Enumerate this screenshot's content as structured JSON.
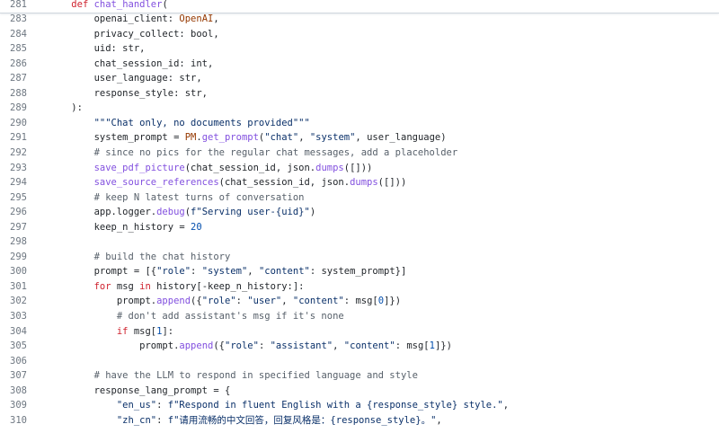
{
  "code_view": {
    "sticky_header": {
      "line_no": "281",
      "tokens": [
        {
          "t": "    "
        },
        {
          "t": "def",
          "c": "kw"
        },
        {
          "t": " "
        },
        {
          "t": "chat_handler",
          "c": "fn"
        },
        {
          "t": "("
        }
      ]
    },
    "lines": [
      {
        "no": "283",
        "tokens": [
          {
            "t": "        openai_client: "
          },
          {
            "t": "OpenAI",
            "c": "cls"
          },
          {
            "t": ","
          }
        ]
      },
      {
        "no": "284",
        "tokens": [
          {
            "t": "        privacy_collect: bool,"
          }
        ]
      },
      {
        "no": "285",
        "tokens": [
          {
            "t": "        uid: str,"
          }
        ]
      },
      {
        "no": "286",
        "tokens": [
          {
            "t": "        chat_session_id: int,"
          }
        ]
      },
      {
        "no": "287",
        "tokens": [
          {
            "t": "        user_language: str,"
          }
        ]
      },
      {
        "no": "288",
        "tokens": [
          {
            "t": "        response_style: str,"
          }
        ]
      },
      {
        "no": "289",
        "tokens": [
          {
            "t": "    ):"
          }
        ]
      },
      {
        "no": "290",
        "tokens": [
          {
            "t": "        "
          },
          {
            "t": "\"\"\"Chat only, no documents provided\"\"\"",
            "c": "str"
          }
        ]
      },
      {
        "no": "291",
        "tokens": [
          {
            "t": "        system_prompt = "
          },
          {
            "t": "PM",
            "c": "cls"
          },
          {
            "t": "."
          },
          {
            "t": "get_prompt",
            "c": "fn"
          },
          {
            "t": "("
          },
          {
            "t": "\"chat\"",
            "c": "str"
          },
          {
            "t": ", "
          },
          {
            "t": "\"system\"",
            "c": "str"
          },
          {
            "t": ", user_language)"
          }
        ]
      },
      {
        "no": "292",
        "tokens": [
          {
            "t": "        "
          },
          {
            "t": "# since no pics for the regular chat messages, add a placeholder",
            "c": "com"
          }
        ]
      },
      {
        "no": "293",
        "tokens": [
          {
            "t": "        "
          },
          {
            "t": "save_pdf_picture",
            "c": "fn"
          },
          {
            "t": "(chat_session_id, json."
          },
          {
            "t": "dumps",
            "c": "fn"
          },
          {
            "t": "([]))"
          }
        ]
      },
      {
        "no": "294",
        "tokens": [
          {
            "t": "        "
          },
          {
            "t": "save_source_references",
            "c": "fn"
          },
          {
            "t": "(chat_session_id, json."
          },
          {
            "t": "dumps",
            "c": "fn"
          },
          {
            "t": "([]))"
          }
        ]
      },
      {
        "no": "295",
        "tokens": [
          {
            "t": "        "
          },
          {
            "t": "# keep N latest turns of conversation",
            "c": "com"
          }
        ]
      },
      {
        "no": "296",
        "tokens": [
          {
            "t": "        app.logger."
          },
          {
            "t": "debug",
            "c": "fn"
          },
          {
            "t": "("
          },
          {
            "t": "f\"Serving user-{uid}\"",
            "c": "str"
          },
          {
            "t": ")"
          }
        ]
      },
      {
        "no": "297",
        "tokens": [
          {
            "t": "        keep_n_history = "
          },
          {
            "t": "20",
            "c": "num"
          }
        ]
      },
      {
        "no": "298",
        "tokens": [
          {
            "t": ""
          }
        ]
      },
      {
        "no": "299",
        "tokens": [
          {
            "t": "        "
          },
          {
            "t": "# build the chat history",
            "c": "com"
          }
        ]
      },
      {
        "no": "300",
        "tokens": [
          {
            "t": "        prompt = [{"
          },
          {
            "t": "\"role\"",
            "c": "str"
          },
          {
            "t": ": "
          },
          {
            "t": "\"system\"",
            "c": "str"
          },
          {
            "t": ", "
          },
          {
            "t": "\"content\"",
            "c": "str"
          },
          {
            "t": ": system_prompt}]"
          }
        ]
      },
      {
        "no": "301",
        "tokens": [
          {
            "t": "        "
          },
          {
            "t": "for",
            "c": "kw"
          },
          {
            "t": " msg "
          },
          {
            "t": "in",
            "c": "kw"
          },
          {
            "t": " history[-keep_n_history:]:"
          }
        ]
      },
      {
        "no": "302",
        "tokens": [
          {
            "t": "            prompt."
          },
          {
            "t": "append",
            "c": "fn"
          },
          {
            "t": "({"
          },
          {
            "t": "\"role\"",
            "c": "str"
          },
          {
            "t": ": "
          },
          {
            "t": "\"user\"",
            "c": "str"
          },
          {
            "t": ", "
          },
          {
            "t": "\"content\"",
            "c": "str"
          },
          {
            "t": ": msg["
          },
          {
            "t": "0",
            "c": "num"
          },
          {
            "t": "]})"
          }
        ]
      },
      {
        "no": "303",
        "tokens": [
          {
            "t": "            "
          },
          {
            "t": "# don't add assistant's msg if it's none",
            "c": "com"
          }
        ]
      },
      {
        "no": "304",
        "tokens": [
          {
            "t": "            "
          },
          {
            "t": "if",
            "c": "kw"
          },
          {
            "t": " msg["
          },
          {
            "t": "1",
            "c": "num"
          },
          {
            "t": "]:"
          }
        ]
      },
      {
        "no": "305",
        "tokens": [
          {
            "t": "                prompt."
          },
          {
            "t": "append",
            "c": "fn"
          },
          {
            "t": "({"
          },
          {
            "t": "\"role\"",
            "c": "str"
          },
          {
            "t": ": "
          },
          {
            "t": "\"assistant\"",
            "c": "str"
          },
          {
            "t": ", "
          },
          {
            "t": "\"content\"",
            "c": "str"
          },
          {
            "t": ": msg["
          },
          {
            "t": "1",
            "c": "num"
          },
          {
            "t": "]})"
          }
        ]
      },
      {
        "no": "306",
        "tokens": [
          {
            "t": ""
          }
        ]
      },
      {
        "no": "307",
        "tokens": [
          {
            "t": "        "
          },
          {
            "t": "# have the LLM to respond in specified language and style",
            "c": "com"
          }
        ]
      },
      {
        "no": "308",
        "tokens": [
          {
            "t": "        response_lang_prompt = {"
          }
        ]
      },
      {
        "no": "309",
        "tokens": [
          {
            "t": "            "
          },
          {
            "t": "\"en_us\"",
            "c": "str"
          },
          {
            "t": ": "
          },
          {
            "t": "f\"Respond in fluent English with a {response_style} style.\"",
            "c": "str"
          },
          {
            "t": ","
          }
        ]
      },
      {
        "no": "310",
        "tokens": [
          {
            "t": "            "
          },
          {
            "t": "\"zh_cn\"",
            "c": "str"
          },
          {
            "t": ": "
          },
          {
            "t": "f\"请用流畅的中文回答，回复风格是：{response_style}。\"",
            "c": "str"
          },
          {
            "t": ","
          }
        ]
      }
    ]
  }
}
